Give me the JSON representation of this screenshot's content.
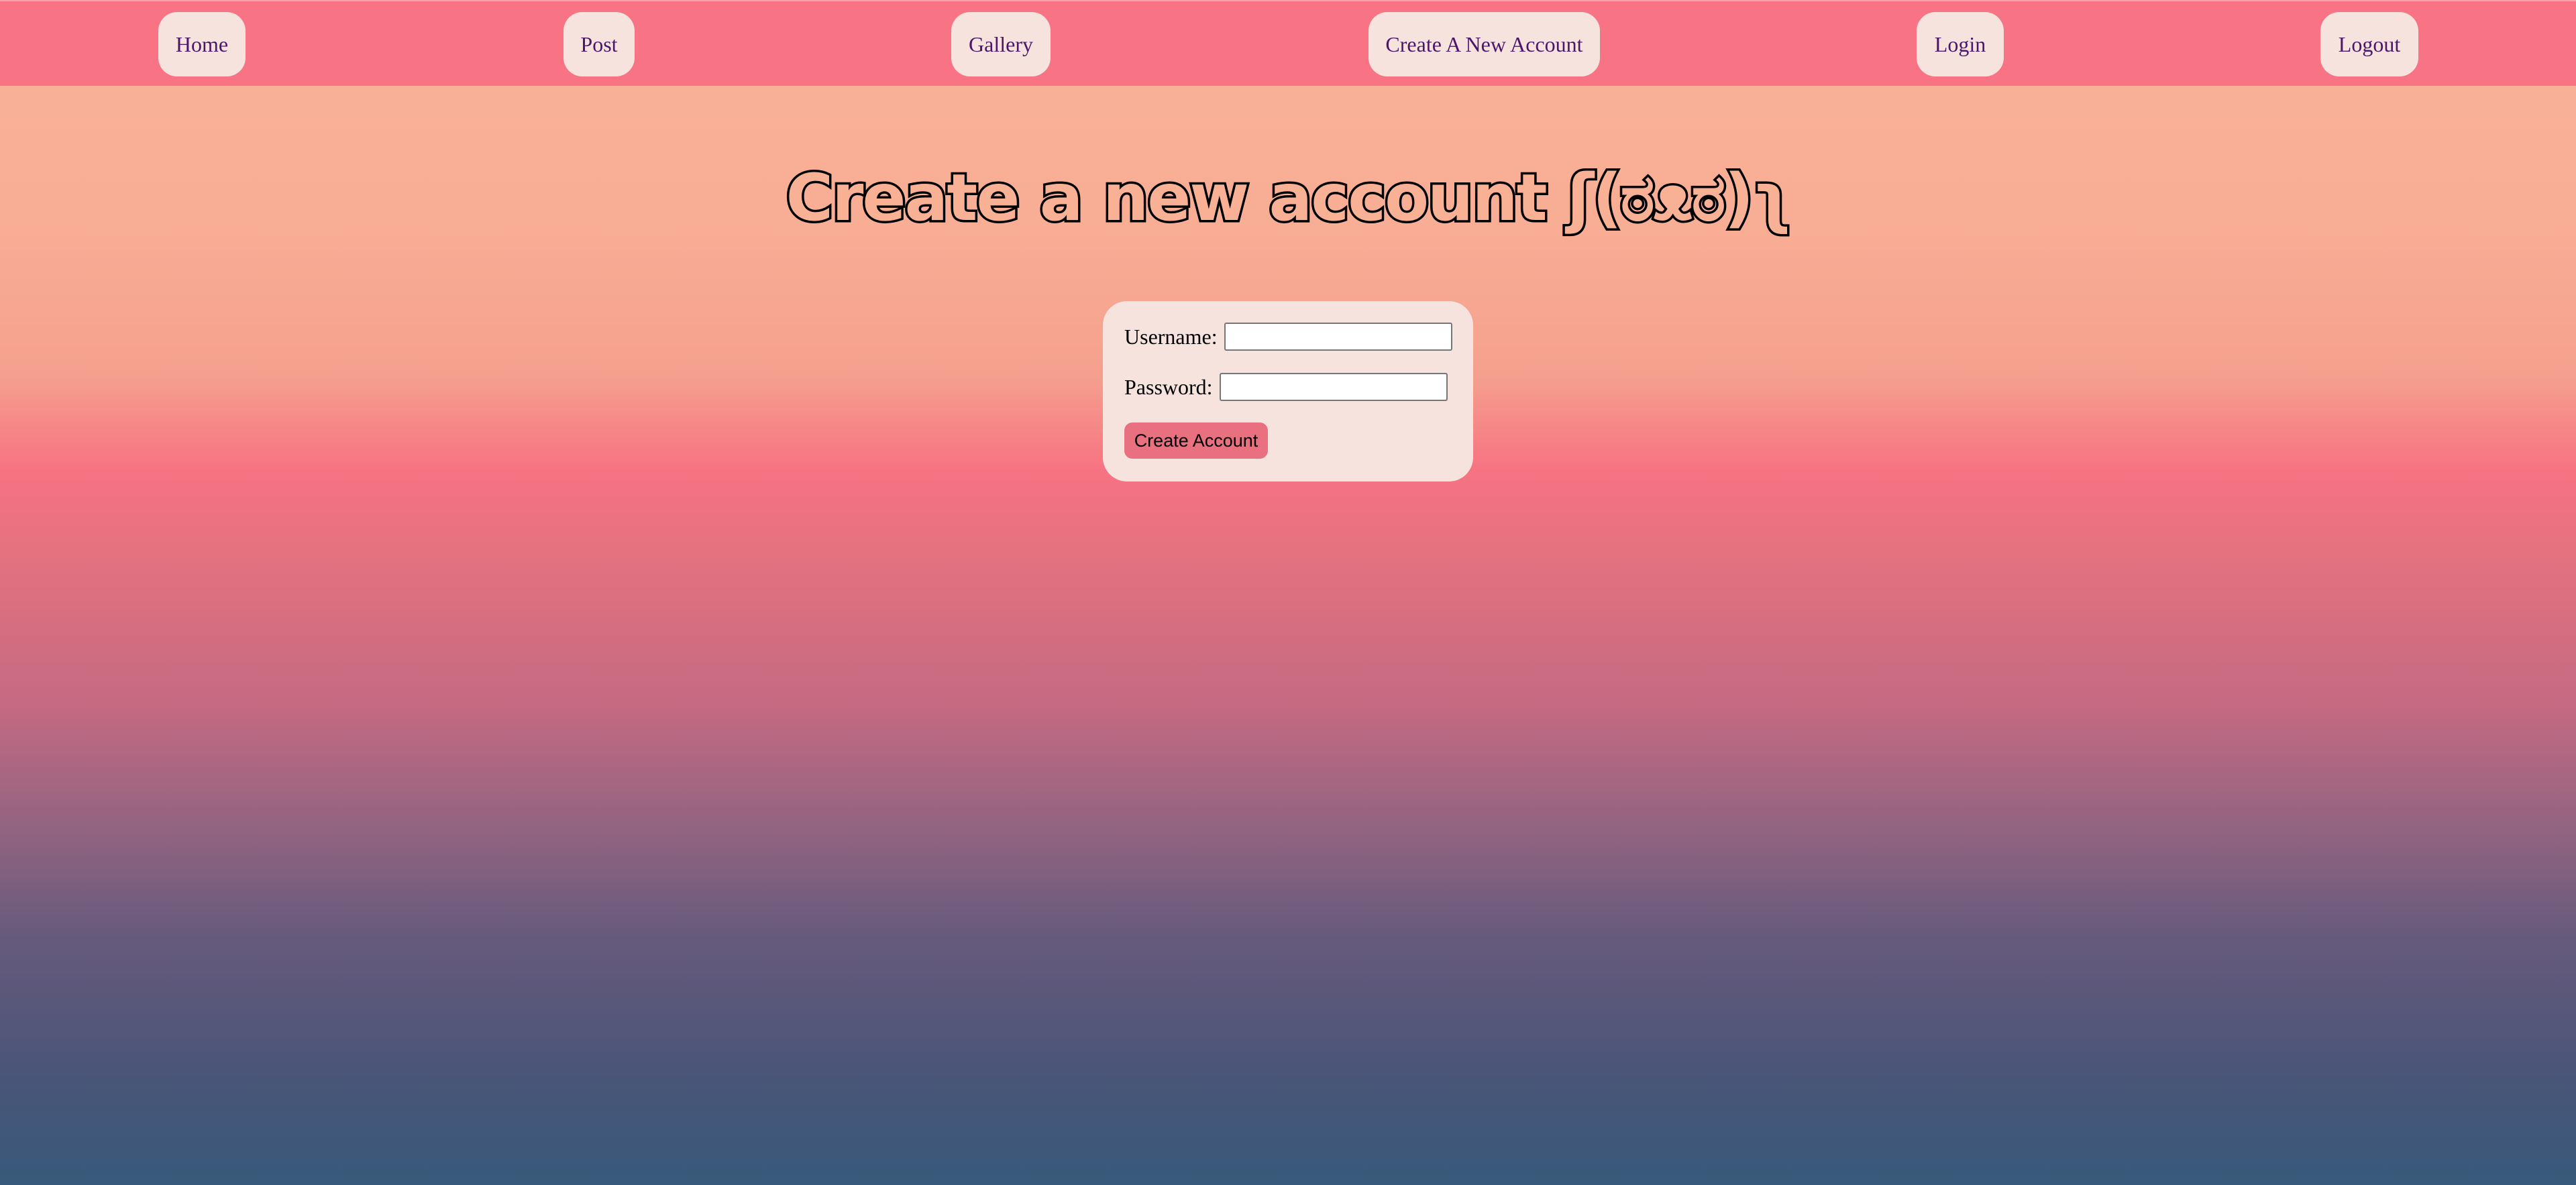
{
  "nav": {
    "home": "Home",
    "post": "Post",
    "gallery": "Gallery",
    "create_account": "Create A New Account",
    "login": "Login",
    "logout": "Logout"
  },
  "page": {
    "title": "Create a new account ʃ(ಠᴥಠ)ʅ"
  },
  "form": {
    "username_label": "Username:",
    "username_value": "",
    "password_label": "Password:",
    "password_value": "",
    "submit_label": "Create Account"
  },
  "colors": {
    "navbar": "#f87484",
    "nav_item_bg": "#f6e3de",
    "nav_text": "#4a176b",
    "card_bg": "#f6e3de",
    "button_bg": "#e9707e"
  }
}
